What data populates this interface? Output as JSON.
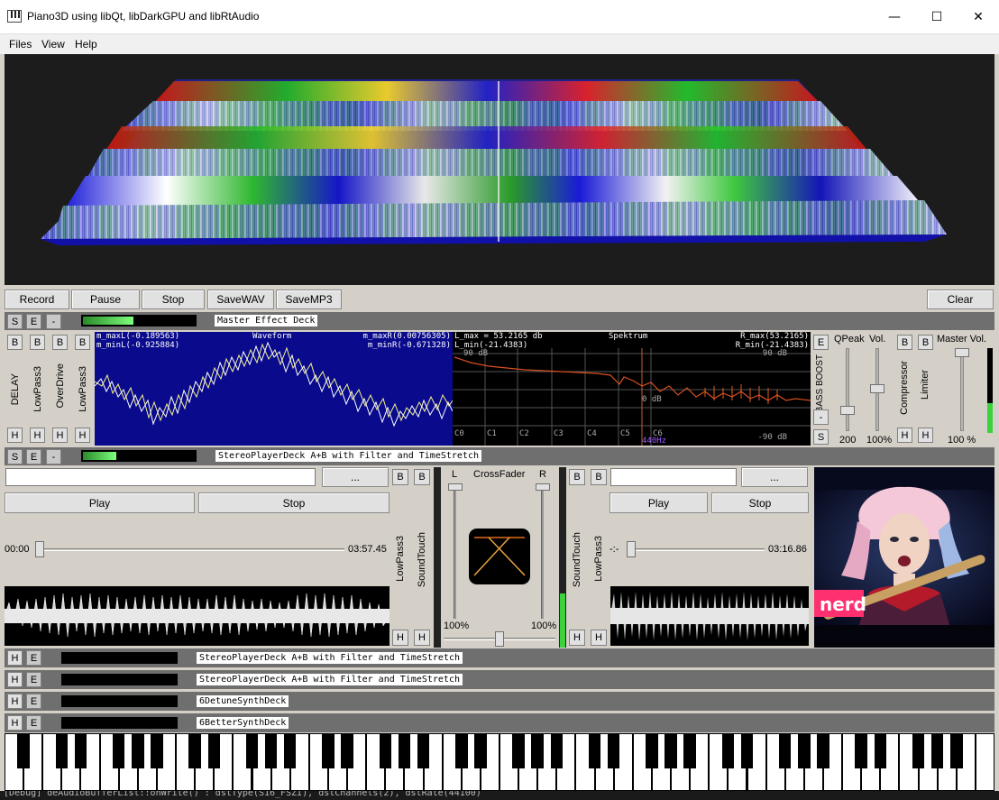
{
  "window": {
    "title": "Piano3D using libQt, libDarkGPU and libRtAudio",
    "minimize": "—",
    "maximize": "☐",
    "close": "✕"
  },
  "menu": [
    "Files",
    "View",
    "Help"
  ],
  "toolbar": {
    "record": "Record",
    "pause": "Pause",
    "stop": "Stop",
    "save_wav": "SaveWAV",
    "save_mp3": "SaveMP3",
    "clear": "Clear"
  },
  "master_deck": {
    "s": "S",
    "e": "E",
    "dash": "-",
    "label": "Master Effect Deck",
    "level": 0.45
  },
  "effects": {
    "b": "B",
    "h": "H",
    "names": [
      "DELAY",
      "LowPass3",
      "OverDrive",
      "LowPass3"
    ]
  },
  "waveform": {
    "title": "Waveform",
    "max_l": "m_maxL(-0.189563)",
    "min_l": "m_minL(-0.925884)",
    "max_r": "m_maxR(0.00756305)",
    "min_r": "m_minR(-0.671328)"
  },
  "spectrum": {
    "title": "Spektrum",
    "l_max": "L_max = 53.2165 db",
    "l_min": "L_min(-21.4383)",
    "r_max": "R_max(53.2165)",
    "r_min": "R_min(-21.4383)",
    "db_top_left": "90 dB",
    "db_top_right": "90 dB",
    "db_zero": "0 dB",
    "db_bottom": "-90 dB",
    "notes": [
      "C0",
      "C1",
      "C2",
      "C3",
      "C4",
      "C5",
      "C6"
    ],
    "hz": "440Hz"
  },
  "master_right": {
    "e": "E",
    "s": "S",
    "dash": "-",
    "bass_boost": "BASS BOOST",
    "qpeak": "QPeak",
    "vol": "Vol.",
    "qpeak_value": "200",
    "vol_value": "100%",
    "compressor": "Compressor",
    "limiter": "Limiter",
    "b": "B",
    "h": "H",
    "master_vol": "Master Vol.",
    "master_vol_value": "100 %",
    "master_level": 0.35
  },
  "player_deck": {
    "s": "S",
    "e": "E",
    "dash": "-",
    "label": "StereoPlayerDeck A+B with Filter and TimeStretch",
    "level": 0.3
  },
  "player_a": {
    "browse": "...",
    "play": "Play",
    "stop": "Stop",
    "pos": "00:00",
    "length": "03:57.45",
    "b": "B",
    "h": "H",
    "lowpass": "LowPass3",
    "soundtouch": "SoundTouch",
    "progress": 0.0
  },
  "crossfader": {
    "title": "CrossFader",
    "l": "L",
    "r": "R",
    "l_value": "100%",
    "r_value": "100%",
    "position": 0.5
  },
  "player_b": {
    "browse": "...",
    "play": "Play",
    "stop": "Stop",
    "pos": "-:-",
    "length": "03:16.86",
    "b": "B",
    "h": "H",
    "lowpass": "LowPass3",
    "soundtouch": "SoundTouch",
    "progress": 0.0
  },
  "video": {
    "logo": "nerd"
  },
  "bottom_decks": [
    {
      "h": "H",
      "e": "E",
      "label": "StereoPlayerDeck A+B with Filter and TimeStretch"
    },
    {
      "h": "H",
      "e": "E",
      "label": "StereoPlayerDeck A+B with Filter and TimeStretch"
    },
    {
      "h": "H",
      "e": "E",
      "label": "6DetuneSynthDeck"
    },
    {
      "h": "H",
      "e": "E",
      "label": "6BetterSynthDeck"
    }
  ],
  "status": "[Debug] deAudioBufferList::onWrite() : dstType(S16_FSZI), dstChannels(2), dstRate(44100)"
}
